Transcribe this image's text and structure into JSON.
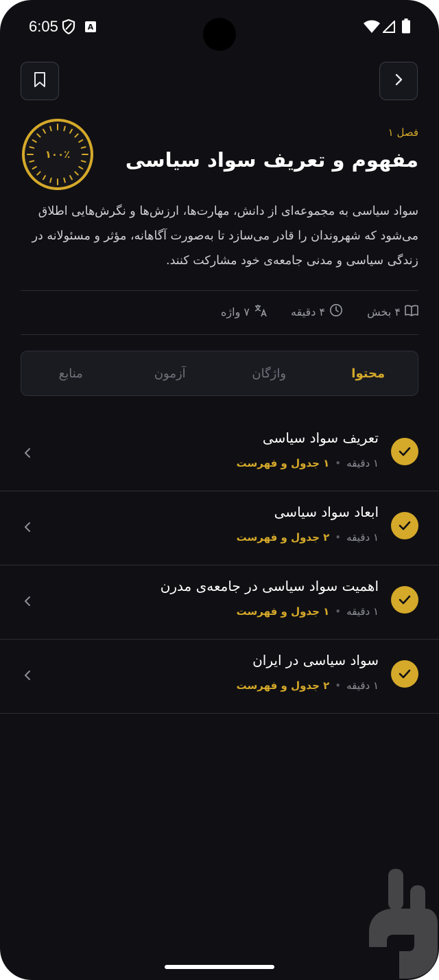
{
  "status_bar": {
    "time": "6:05"
  },
  "header": {
    "chapter_label": "فصل ۱",
    "title": "مفهوم و تعریف سواد سیاسی",
    "progress_text": "۱۰۰٪",
    "progress": 1.0,
    "description": "سواد سیاسی به مجموعه‌ای از دانش، مهارت‌ها، ارزش‌ها و نگرش‌هایی اطلاق می‌شود که شهروندان را قادر می‌سازد تا به‌صورت آگاهانه، مؤثر و مسئولانه در زندگی سیاسی و مدنی جامعه‌ی خود مشارکت کنند."
  },
  "meta": {
    "sections": "۴ بخش",
    "duration": "۴ دقیقه",
    "words": "۷ واژه"
  },
  "tabs": [
    {
      "label": "محتوا",
      "active": true
    },
    {
      "label": "واژگان",
      "active": false
    },
    {
      "label": "آزمون",
      "active": false
    },
    {
      "label": "منابع",
      "active": false
    }
  ],
  "lessons": [
    {
      "title": "تعریف سواد سیاسی",
      "duration": "۱ دقیقه",
      "tables": "۱ جدول و فهرست"
    },
    {
      "title": "ابعاد سواد سیاسی",
      "duration": "۱ دقیقه",
      "tables": "۲ جدول و فهرست"
    },
    {
      "title": "اهمیت سواد سیاسی در جامعه‌ی مدرن",
      "duration": "۱ دقیقه",
      "tables": "۱ جدول و فهرست"
    },
    {
      "title": "سواد سیاسی در ایران",
      "duration": "۱ دقیقه",
      "tables": "۲ جدول و فهرست"
    }
  ],
  "colors": {
    "accent": "#d5a92a",
    "background": "#101014"
  }
}
